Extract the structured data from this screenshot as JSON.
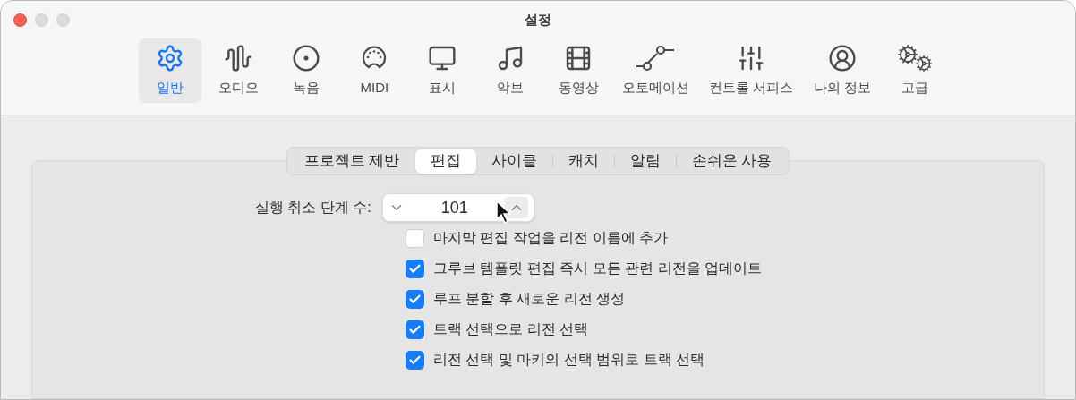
{
  "window": {
    "title": "설정"
  },
  "toolbar": [
    {
      "kind": "general",
      "label": "일반",
      "selected": true
    },
    {
      "kind": "audio",
      "label": "오디오",
      "selected": false
    },
    {
      "kind": "record",
      "label": "녹음",
      "selected": false
    },
    {
      "kind": "midi",
      "label": "MIDI",
      "selected": false
    },
    {
      "kind": "display",
      "label": "표시",
      "selected": false
    },
    {
      "kind": "score",
      "label": "악보",
      "selected": false
    },
    {
      "kind": "movie",
      "label": "동영상",
      "selected": false
    },
    {
      "kind": "automation",
      "label": "오토메이션",
      "selected": false
    },
    {
      "kind": "control",
      "label": "컨트롤 서피스",
      "selected": false
    },
    {
      "kind": "account",
      "label": "나의 정보",
      "selected": false
    },
    {
      "kind": "advanced",
      "label": "고급",
      "selected": false
    }
  ],
  "tabs": [
    {
      "label": "프로젝트 제반",
      "selected": false
    },
    {
      "label": "편집",
      "selected": true
    },
    {
      "label": "사이클",
      "selected": false
    },
    {
      "label": "캐치",
      "selected": false
    },
    {
      "label": "알림",
      "selected": false
    },
    {
      "label": "손쉬운 사용",
      "selected": false
    }
  ],
  "undo_steps": {
    "label": "실행 취소 단계 수:",
    "value": "101"
  },
  "options": [
    {
      "label": "마지막 편집 작업을 리전 이름에 추가",
      "checked": false
    },
    {
      "label": "그루브 템플릿 편집 즉시 모든 관련 리전을 업데이트",
      "checked": true
    },
    {
      "label": "루프 분할 후 새로운 리전 생성",
      "checked": true
    },
    {
      "label": "트랙 선택으로 리전 선택",
      "checked": true
    },
    {
      "label": "리전 선택 및 마키의 선택 범위로 트랙 선택",
      "checked": true
    }
  ]
}
